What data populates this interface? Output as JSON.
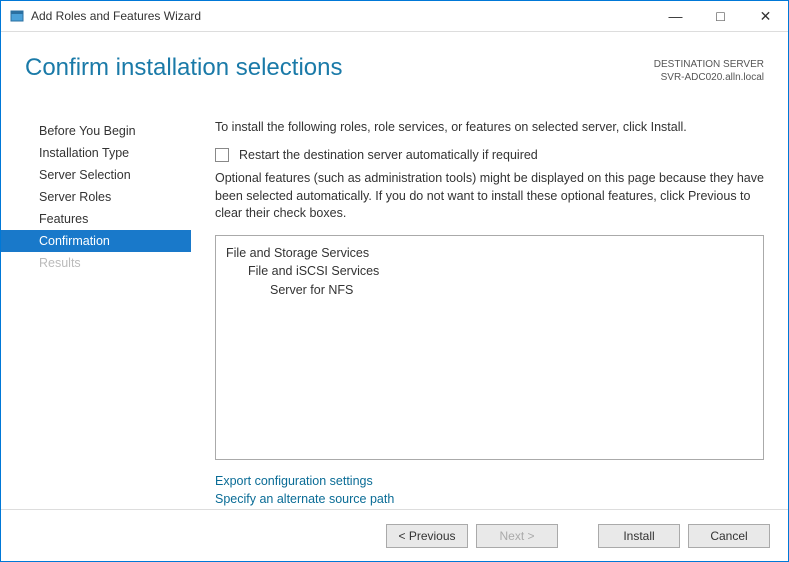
{
  "window": {
    "title": "Add Roles and Features Wizard"
  },
  "header": {
    "title": "Confirm installation selections",
    "destination_label": "DESTINATION SERVER",
    "destination_value": "SVR-ADC020.alln.local"
  },
  "sidebar": {
    "items": [
      {
        "label": "Before You Begin",
        "state": "normal"
      },
      {
        "label": "Installation Type",
        "state": "normal"
      },
      {
        "label": "Server Selection",
        "state": "normal"
      },
      {
        "label": "Server Roles",
        "state": "normal"
      },
      {
        "label": "Features",
        "state": "normal"
      },
      {
        "label": "Confirmation",
        "state": "selected"
      },
      {
        "label": "Results",
        "state": "disabled"
      }
    ]
  },
  "main": {
    "intro": "To install the following roles, role services, or features on selected server, click Install.",
    "restart_checkbox_label": "Restart the destination server automatically if required",
    "restart_checked": false,
    "optional_text": "Optional features (such as administration tools) might be displayed on this page because they have been selected automatically. If you do not want to install these optional features, click Previous to clear their check boxes.",
    "features": [
      {
        "label": "File and Storage Services",
        "level": 1
      },
      {
        "label": "File and iSCSI Services",
        "level": 2
      },
      {
        "label": "Server for NFS",
        "level": 3
      }
    ],
    "link_export": "Export configuration settings",
    "link_source": "Specify an alternate source path"
  },
  "buttons": {
    "previous": "< Previous",
    "next": "Next >",
    "install": "Install",
    "cancel": "Cancel"
  }
}
